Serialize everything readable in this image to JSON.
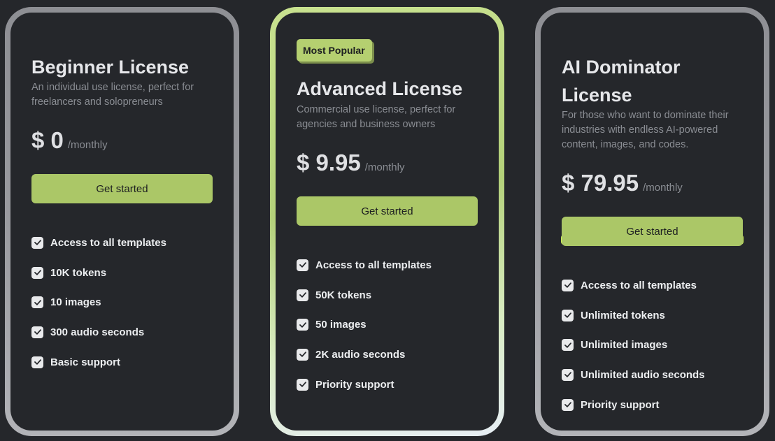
{
  "plans": [
    {
      "badge": "",
      "title": "Beginner License",
      "description": "An individual use license, perfect for freelancers and solopreneurs",
      "price": "$ 0",
      "period": "/monthly",
      "cta": "Get started",
      "features": [
        "Access to all templates",
        "10K tokens",
        "10 images",
        "300 audio seconds",
        "Basic support"
      ]
    },
    {
      "badge": "Most Popular",
      "title": "Advanced License",
      "description": "Commercial use license, perfect for agencies and business owners",
      "price": "$ 9.95",
      "period": "/monthly",
      "cta": "Get started",
      "features": [
        "Access to all templates",
        "50K tokens",
        "50 images",
        "2K audio seconds",
        "Priority support"
      ]
    },
    {
      "badge": "",
      "title": "AI Dominator License",
      "description": "For those who want to dominate their industries with endless AI-powered content, images, and codes.",
      "price": "$ 79.95",
      "period": "/monthly",
      "cta": "Get started",
      "features": [
        "Access to all templates",
        "Unlimited tokens",
        "Unlimited images",
        "Unlimited audio seconds",
        "Priority support"
      ]
    }
  ],
  "colors": {
    "background": "#25272b",
    "accent": "#abc767",
    "accent_bright": "#cdf05a",
    "heading": "#e6e7ea",
    "muted": "#8a8d93"
  },
  "icons": {
    "feature_icon": "check-icon"
  }
}
